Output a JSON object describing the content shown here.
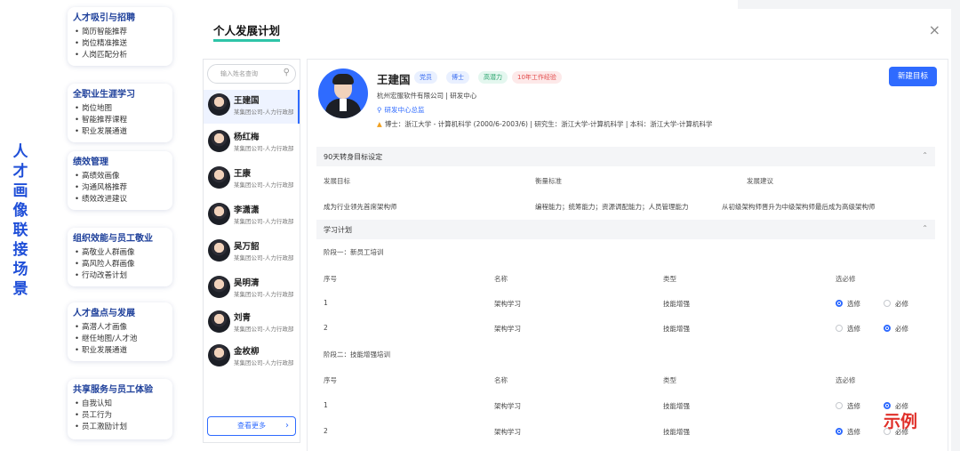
{
  "side_title": [
    "人",
    "才",
    "画",
    "像",
    "联",
    "接",
    "场",
    "景"
  ],
  "categories": [
    {
      "title": "人才吸引与招聘",
      "items": [
        "简历智能推荐",
        "岗位精准推送",
        "人岗匹配分析"
      ]
    },
    {
      "title": "全职业生涯学习",
      "items": [
        "岗位地图",
        "智能推荐课程",
        "职业发展通道"
      ]
    },
    {
      "title": "绩效管理",
      "items": [
        "高绩效画像",
        "沟通风格推荐",
        "绩效改进建议"
      ]
    },
    {
      "title": "组织效能与员工敬业",
      "items": [
        "高敬业人群画像",
        "高风险人群画像",
        "行动改善计划"
      ]
    },
    {
      "title": "人才盘点与发展",
      "items": [
        "高潜人才画像",
        "继任地图/人才池",
        "职业发展通道"
      ]
    },
    {
      "title": "共享服务与员工体验",
      "items": [
        "自我认知",
        "员工行为",
        "员工激励计划"
      ]
    }
  ],
  "panel": {
    "title": "个人发展计划",
    "close": "×"
  },
  "search": {
    "placeholder": "输入姓名查询"
  },
  "people": [
    {
      "name": "王建国",
      "org": "某集团公司-人力行政部"
    },
    {
      "name": "杨红梅",
      "org": "某集团公司-人力行政部"
    },
    {
      "name": "王康",
      "org": "某集团公司-人力行政部"
    },
    {
      "name": "李潇潇",
      "org": "某集团公司-人力行政部"
    },
    {
      "name": "吴万韶",
      "org": "某集团公司-人力行政部"
    },
    {
      "name": "吴明清",
      "org": "某集团公司-人力行政部"
    },
    {
      "name": "刘青",
      "org": "某集团公司-人力行政部"
    },
    {
      "name": "金枚柳",
      "org": "某集团公司-人力行政部"
    }
  ],
  "more_label": "查看更多",
  "profile": {
    "name": "王建国",
    "tags": [
      "党员",
      "博士",
      "高潜力",
      "10年工作经验"
    ],
    "company": "杭州宏服软件有限公司 | 研发中心",
    "position": "研发中心总监",
    "education": "博士：浙江大学 - 计算机科学 (2000/6-2003/6)  |  研究生：浙江大学-计算机科学  |  本科：浙江大学-计算机科学",
    "new_goal_label": "新建目标"
  },
  "goal_section": {
    "title": "90天转身目标设定",
    "headers": [
      "发展目标",
      "衡量标准",
      "发展建议"
    ],
    "row": [
      "成为行业领先首席架构师",
      "编程能力；统筹能力；资源调配能力；人员管理能力",
      "从初级架构师晋升为中级架构师最后成为高级架构师"
    ]
  },
  "study_section": {
    "title": "学习计划",
    "headers": [
      "序号",
      "名称",
      "类型",
      "选必修"
    ],
    "option_labels": [
      "选修",
      "必修"
    ],
    "stages": [
      {
        "title": "阶段一：新员工培训",
        "rows": [
          {
            "no": "1",
            "name": "架构学习",
            "type": "技能增强",
            "selected": "选修"
          },
          {
            "no": "2",
            "name": "架构学习",
            "type": "技能增强",
            "selected": "必修"
          }
        ]
      },
      {
        "title": "阶段二：技能增强培训",
        "rows": [
          {
            "no": "1",
            "name": "架构学习",
            "type": "技能增强",
            "selected": "必修"
          },
          {
            "no": "2",
            "name": "架构学习",
            "type": "技能增强",
            "selected": "选修"
          }
        ]
      }
    ]
  },
  "example_label": "示例",
  "colors": {
    "accent": "#2f6bff",
    "title_underline": "#2ec4a8",
    "example_red": "#e0302a",
    "side_title": "#1f4fd8"
  }
}
